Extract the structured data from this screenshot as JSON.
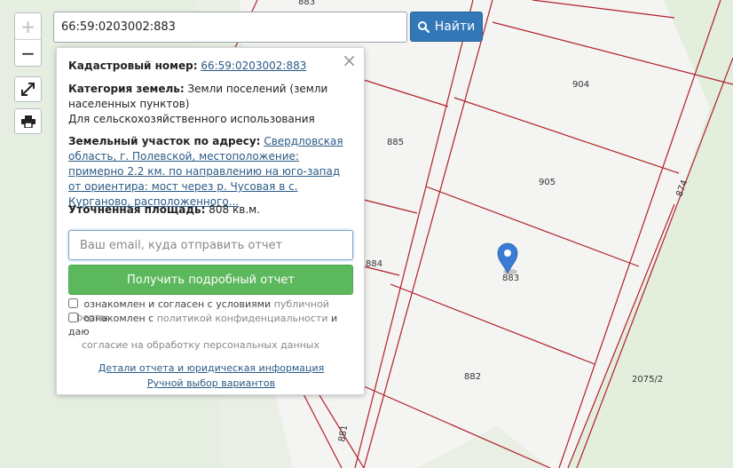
{
  "search": {
    "value": "66:59:0203002:883",
    "button_label": "Найти"
  },
  "controls": {
    "zoom_in": "+",
    "zoom_out": "−"
  },
  "map": {
    "plot_labels": {
      "p904": "904",
      "p885": "885",
      "p905": "905",
      "p874": "874",
      "p883": "883",
      "p884": "884",
      "p882": "882",
      "p20752": "2075/2",
      "p881": "881",
      "ptop": "883"
    },
    "colors": {
      "boundary": "#b0202c",
      "marker": "#3a7bd5"
    }
  },
  "popup": {
    "close": "×",
    "cadastral_label": "Кадастровый номер:",
    "cadastral_value": "66:59:0203002:883",
    "category_label": "Категория земель:",
    "category_value": "Земли поселений (земли населенных пунктов)",
    "use_value": "Для сельскохозяйственного использования",
    "address_label": "Земельный участок по адресу:",
    "address_value": "Свердловская область, г. Полевской, местоположение: примерно 2.2 км. по направлению на юго-запад от ориентира: мост через р. Чусовая в с. Курганово, расположенного...",
    "area_label": "Уточненная площадь:",
    "area_value": "808 кв.м.",
    "email_placeholder": "Ваш email, куда отправить отчет",
    "report_button": "Получить подробный отчет",
    "agree1_text": "ознакомлен и согласен с условиями",
    "agree1_link": "публичной оферты",
    "agree2_text": "ознакомлен с",
    "agree2_link": "политикой конфиденциальности",
    "agree2_mid": "и даю",
    "agree2_tail": "согласие на обработку персональных данных",
    "details_link": "Детали отчета и юридическая информация",
    "manual_link": "Ручной выбор вариантов"
  }
}
